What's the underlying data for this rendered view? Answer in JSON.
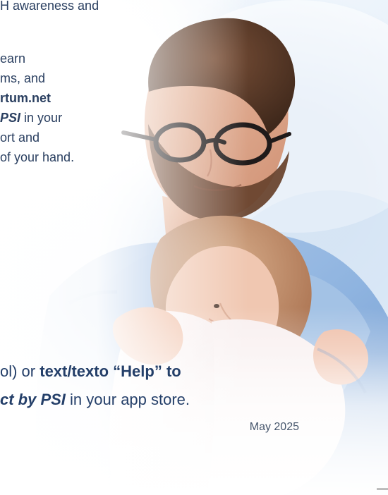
{
  "intro": {
    "line1": "H awareness and",
    "line2": "earn",
    "line3": "ms, and",
    "line4": "rtum.net",
    "line5_bold": "PSI",
    "line5_regular": " in your",
    "line6": "ort and",
    "line7": "of your hand."
  },
  "bottom": {
    "line1_prefix": "ol) or ",
    "line1_bold": "text/texto “Help” to",
    "line2_bold": "ct by PSI",
    "line2_regular": " in your app store.",
    "date": "May 2025"
  },
  "image": {
    "subject": "father-holding-baby-photo",
    "colors": {
      "skin": "#d9a487",
      "hair": "#5a3927",
      "shirt": "#8fb4e0",
      "baby_clothes": "#f5ecec",
      "glasses": "#1f1a1a"
    }
  }
}
